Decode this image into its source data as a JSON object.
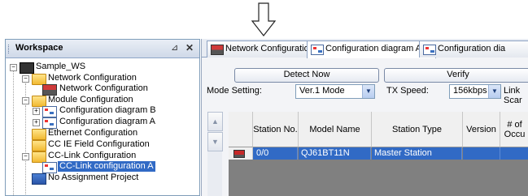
{
  "workspace": {
    "title": "Workspace",
    "pin_icon": "pin-icon",
    "close_icon": "close-icon",
    "tree": [
      {
        "label": "Sample_WS",
        "icon": "workspace-icon",
        "expander": "−"
      },
      {
        "label": "Network Configuration",
        "icon": "folder-icon",
        "expander": "−"
      },
      {
        "label": "Network Configuration",
        "icon": "network-config-icon"
      },
      {
        "label": "Module Configuration",
        "icon": "folder-icon",
        "expander": "−"
      },
      {
        "label": "Configuration diagram B",
        "icon": "diagram-icon",
        "expander": "+"
      },
      {
        "label": "Configuration diagram A",
        "icon": "diagram-icon",
        "expander": "+"
      },
      {
        "label": "Ethernet Configuration",
        "icon": "folder-icon"
      },
      {
        "label": "CC IE Field Configuration",
        "icon": "folder-icon"
      },
      {
        "label": "CC-Link Configuration",
        "icon": "folder-icon",
        "expander": "−"
      },
      {
        "label": "CC-Link configuration A",
        "icon": "diagram-icon",
        "selected": true
      },
      {
        "label": "No Assignment Project",
        "icon": "project-icon"
      }
    ]
  },
  "tabs": [
    {
      "label": "Network Configuration",
      "icon": "network-config-icon"
    },
    {
      "label": "Configuration diagram A",
      "icon": "diagram-icon"
    },
    {
      "label": "Configuration dia",
      "icon": "diagram-icon"
    }
  ],
  "toolbar": {
    "detect_now": "Detect Now",
    "verify": "Verify",
    "mode_label": "Mode Setting:",
    "mode_value": "Ver.1 Mode",
    "tx_label": "TX Speed:",
    "tx_value": "156kbps",
    "link_scan_label": "Link Scar"
  },
  "table": {
    "columns": [
      "Station No.",
      "Model Name",
      "Station Type",
      "Version",
      "# of Occu"
    ],
    "rows": [
      {
        "station_no": "0/0",
        "model": "QJ61BT11N",
        "type": "Master Station",
        "version": "",
        "occupied": ""
      }
    ]
  },
  "colors": {
    "selection": "#316ac5",
    "grid_empty": "#808080"
  }
}
